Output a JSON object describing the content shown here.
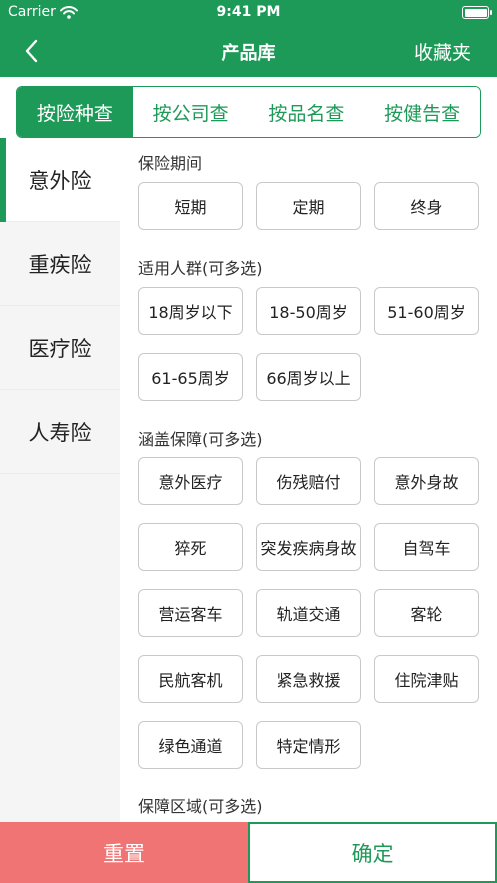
{
  "status_bar": {
    "carrier": "Carrier",
    "time": "9:41 PM"
  },
  "nav": {
    "title": "产品库",
    "favorites": "收藏夹"
  },
  "search_tabs": [
    {
      "label": "按险种查",
      "active": true
    },
    {
      "label": "按公司查",
      "active": false
    },
    {
      "label": "按品名查",
      "active": false
    },
    {
      "label": "按健告查",
      "active": false
    }
  ],
  "sidebar": [
    {
      "label": "意外险",
      "active": true
    },
    {
      "label": "重疾险",
      "active": false
    },
    {
      "label": "医疗险",
      "active": false
    },
    {
      "label": "人寿险",
      "active": false
    }
  ],
  "sections": {
    "period": {
      "title": "保险期间",
      "options": [
        "短期",
        "定期",
        "终身"
      ]
    },
    "crowd": {
      "title": "适用人群(可多选)",
      "options": [
        "18周岁以下",
        "18-50周岁",
        "51-60周岁",
        "61-65周岁",
        "66周岁以上"
      ]
    },
    "coverage": {
      "title": "涵盖保障(可多选)",
      "options": [
        "意外医疗",
        "伤残赔付",
        "意外身故",
        "猝死",
        "突发疾病身故",
        "自驾车",
        "营运客车",
        "轨道交通",
        "客轮",
        "民航客机",
        "紧急救援",
        "住院津贴",
        "绿色通道",
        "特定情形"
      ]
    },
    "region": {
      "title": "保障区域(可多选)"
    }
  },
  "buttons": {
    "reset": "重置",
    "confirm": "确定"
  },
  "colors": {
    "brand_green": "#1e9a58",
    "reset_red": "#f07474"
  }
}
